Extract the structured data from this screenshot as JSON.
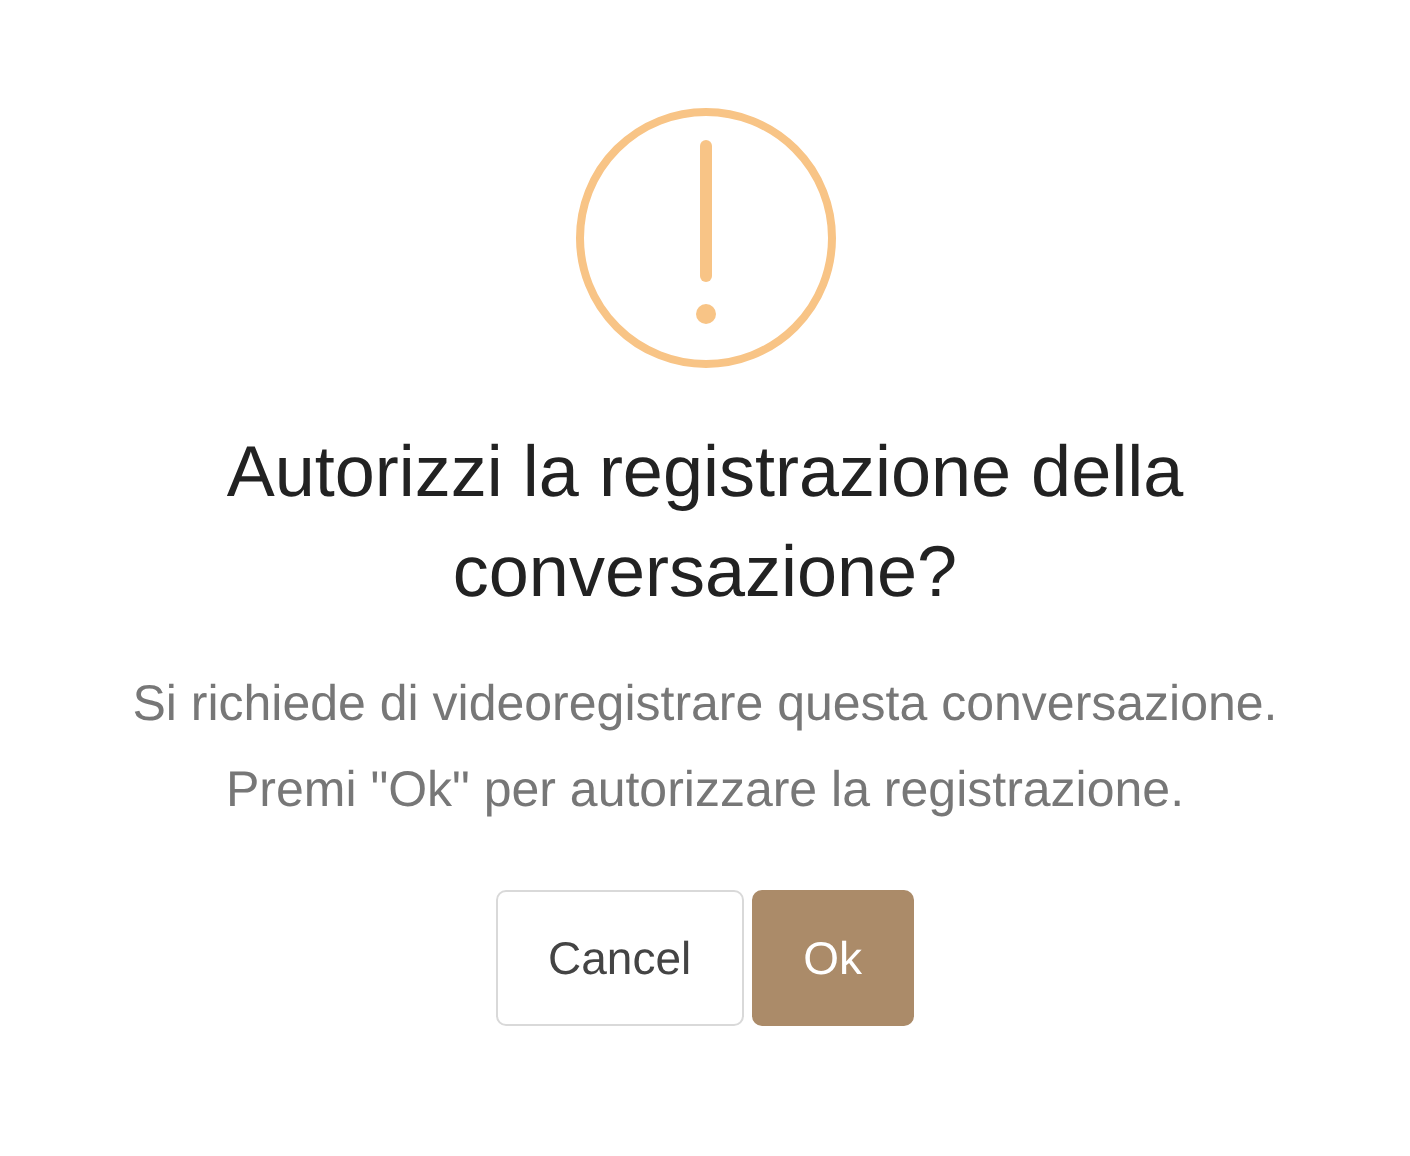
{
  "dialog": {
    "title": "Autorizzi la registrazione della conversazione?",
    "message_lines": [
      "Si richiede di videoregistrare questa conversazione.",
      "Premi \"Ok\" per autorizzare la registrazione."
    ],
    "buttons": [
      {
        "label": "Cancel",
        "kind": "secondary"
      },
      {
        "label": "Ok",
        "kind": "primary"
      }
    ]
  }
}
